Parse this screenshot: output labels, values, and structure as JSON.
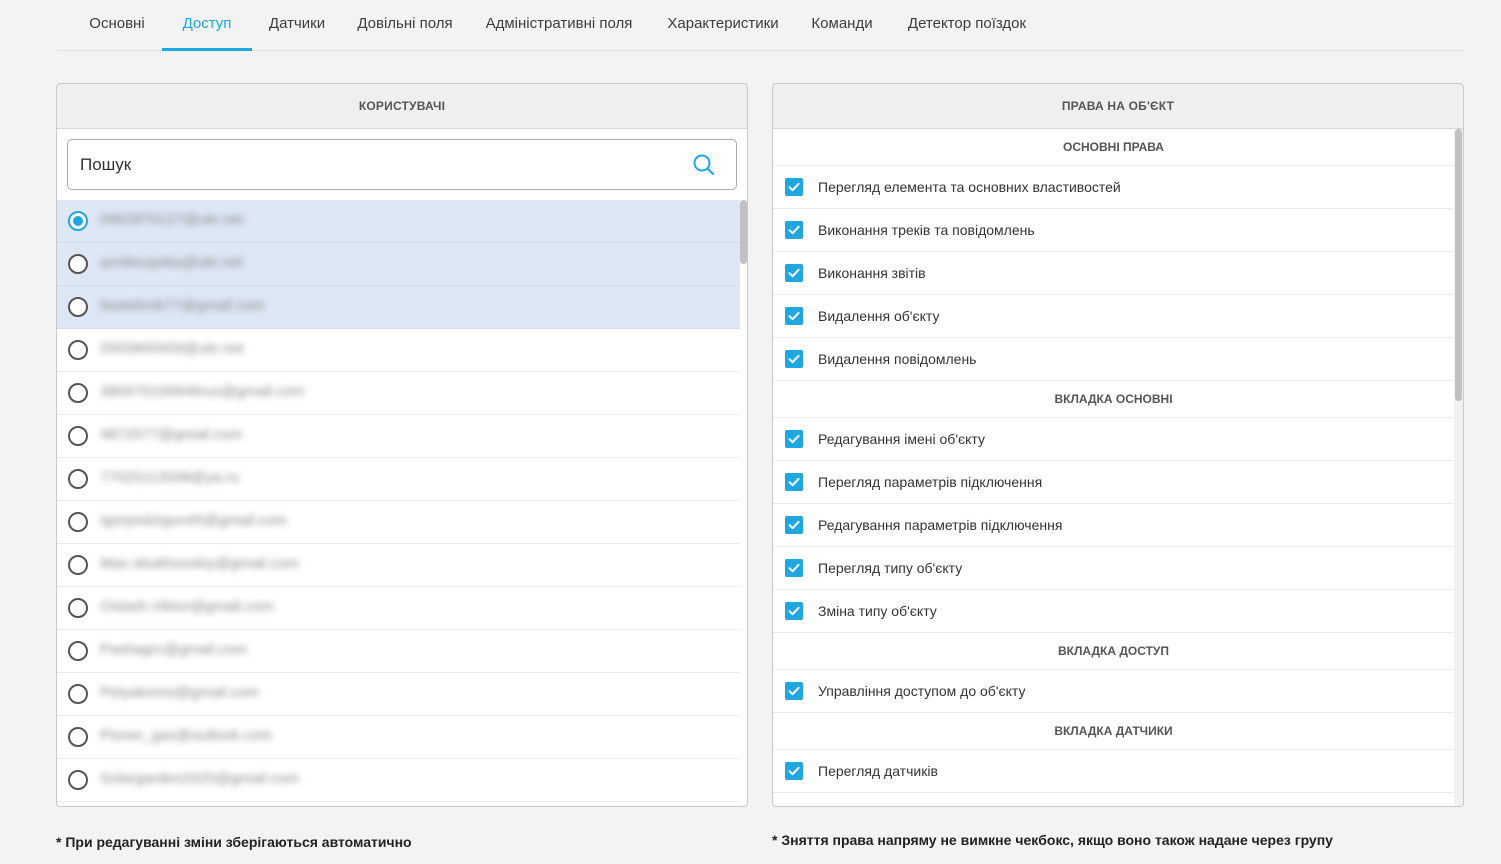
{
  "tabs": [
    {
      "label": "Основні",
      "active": false
    },
    {
      "label": "Доступ",
      "active": true
    },
    {
      "label": "Датчики",
      "active": false
    },
    {
      "label": "Довільні поля",
      "active": false
    },
    {
      "label": "Адміністративні поля",
      "active": false
    },
    {
      "label": "Характеристики",
      "active": false
    },
    {
      "label": "Команди",
      "active": false
    },
    {
      "label": "Детектор поїздок",
      "active": false
    }
  ],
  "users_panel": {
    "title": "КОРИСТУВАЧІ",
    "search": {
      "value": "Пошук",
      "icon": "search-icon"
    },
    "users": [
      {
        "email": "0662870127@ukr.net",
        "selected": true
      },
      {
        "email": "armbezpeka@ukr.net",
        "selected": false
      },
      {
        "email": "fasttehnik77@gmail.com",
        "selected": false
      },
      {
        "email": "0505865959@ukr.net",
        "selected": false
      },
      {
        "email": "380970106946rus@gmail.com",
        "selected": false
      },
      {
        "email": "4872577@gmail.com",
        "selected": false
      },
      {
        "email": "77025113508@ya.ru",
        "selected": false
      },
      {
        "email": "Igorpodzigun45@gmail.com",
        "selected": false
      },
      {
        "email": "Max.obukhovskiy@gmail.com",
        "selected": false
      },
      {
        "email": "Ostash.Viktor@gmail.com",
        "selected": false
      },
      {
        "email": "Pashagrc@gmail.com",
        "selected": false
      },
      {
        "email": "Petyakomo@gmail.com",
        "selected": false
      },
      {
        "email": "Pioner_gas@outlook.com",
        "selected": false
      },
      {
        "email": "Solargarden2025@gmail.com",
        "selected": false
      }
    ]
  },
  "rights_panel": {
    "title": "ПРАВА НА ОБ'ЄКТ",
    "sections": [
      {
        "title": "ОСНОВНІ ПРАВА",
        "items": [
          {
            "label": "Перегляд елемента та основних властивостей",
            "checked": true
          },
          {
            "label": "Виконання треків та повідомлень",
            "checked": true
          },
          {
            "label": "Виконання звітів",
            "checked": true
          },
          {
            "label": "Видалення об'єкту",
            "checked": true
          },
          {
            "label": "Видалення повідомлень",
            "checked": true
          }
        ]
      },
      {
        "title": "ВКЛАДКА ОСНОВНІ",
        "items": [
          {
            "label": "Редагування імені об'єкту",
            "checked": true
          },
          {
            "label": "Перегляд параметрів підключення",
            "checked": true
          },
          {
            "label": "Редагування параметрів підключення",
            "checked": true
          },
          {
            "label": "Перегляд типу об'єкту",
            "checked": true
          },
          {
            "label": "Зміна типу об'єкту",
            "checked": true
          }
        ]
      },
      {
        "title": "ВКЛАДКА ДОСТУП",
        "items": [
          {
            "label": "Управління доступом до об'єкту",
            "checked": true
          }
        ]
      },
      {
        "title": "ВКЛАДКА ДАТЧИКИ",
        "items": [
          {
            "label": "Перегляд датчиків",
            "checked": true
          }
        ]
      }
    ]
  },
  "notes": {
    "left": "* При редагуванні зміни зберігаються автоматично",
    "right": "* Зняття права напряму не вимкне чекбокс, якщо воно також надане через групу"
  },
  "colors": {
    "accent": "#1fa7e0",
    "highlight_row": "#dde7f5"
  }
}
